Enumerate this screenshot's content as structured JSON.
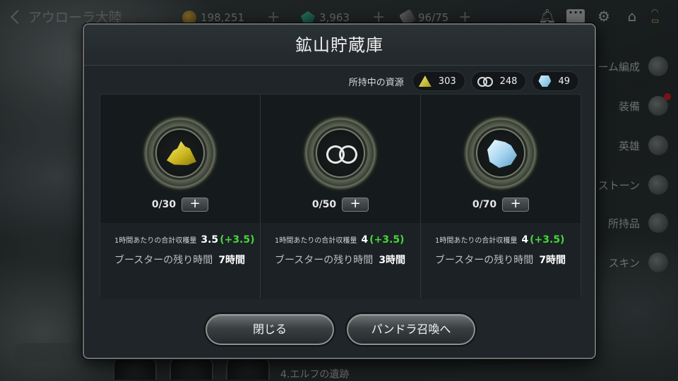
{
  "topbar": {
    "back_label": "アウローラ大陸",
    "gold": "198,251",
    "gems": "3,963",
    "keys": "96/75",
    "plus": "+"
  },
  "side_menu": [
    "ーム編成",
    "装備",
    "英雄",
    "ストーン",
    "所持品",
    "スキン"
  ],
  "footer": {
    "location": "4.エルフの遺跡"
  },
  "modal": {
    "title": "鉱山貯蔵庫",
    "held_label": "所持中の資源",
    "held": [
      {
        "icon": "gold-ore-icon",
        "value": "303"
      },
      {
        "icon": "infinity-icon",
        "value": "248"
      },
      {
        "icon": "crystal-icon",
        "value": "49"
      }
    ],
    "cards": [
      {
        "icon": "gold-ore-icon",
        "count": "0/30",
        "plus": "+",
        "rate_label": "1時間あたりの合計収穫量",
        "rate_value": "3.5",
        "rate_bonus": "(+3.5)",
        "boost_label": "ブースターの残り時間",
        "boost_value": "7時間"
      },
      {
        "icon": "infinity-ore-icon",
        "count": "0/50",
        "plus": "+",
        "rate_label": "1時間あたりの合計収穫量",
        "rate_value": "4",
        "rate_bonus": "(+3.5)",
        "boost_label": "ブースターの残り時間",
        "boost_value": "3時間"
      },
      {
        "icon": "crystal-ore-icon",
        "count": "0/70",
        "plus": "+",
        "rate_label": "1時間あたりの合計収穫量",
        "rate_value": "4",
        "rate_bonus": "(+3.5)",
        "boost_label": "ブースターの残り時間",
        "boost_value": "7時間"
      }
    ],
    "buttons": {
      "close": "閉じる",
      "pandora": "パンドラ召喚へ"
    }
  },
  "colors": {
    "bonus_green": "#49d43c",
    "notification_red": "#e02020"
  }
}
